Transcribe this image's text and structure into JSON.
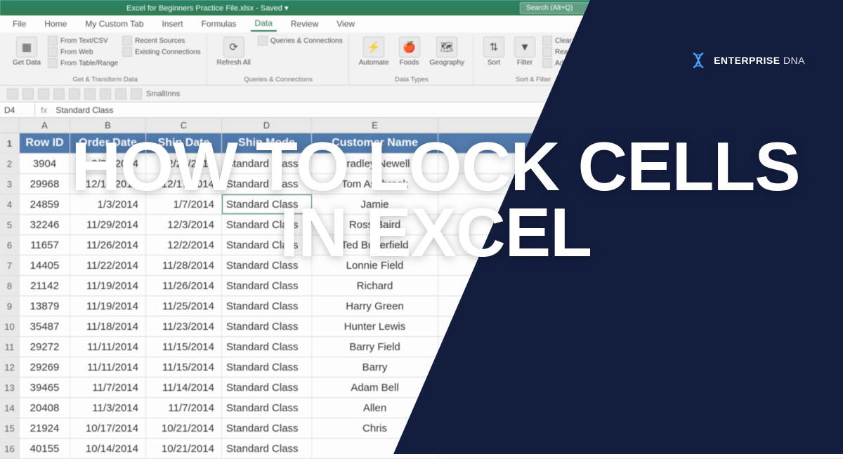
{
  "window": {
    "title": "Excel for Beginners Practice File.xlsx - Saved ▾",
    "search_placeholder": "Search (Alt+Q)"
  },
  "menu": {
    "file": "File",
    "home": "Home",
    "custom": "My Custom Tab",
    "insert": "Insert",
    "formulas": "Formulas",
    "data": "Data",
    "review": "Review",
    "view": "View"
  },
  "ribbon": {
    "get_data": "Get Data",
    "from_text": "From Text/CSV",
    "from_web": "From Web",
    "from_table": "From Table/Range",
    "recent": "Recent Sources",
    "existing": "Existing Connections",
    "group1_label": "Get & Transform Data",
    "refresh": "Refresh All",
    "queries": "Queries & Connections",
    "group2_label": "Queries & Connections",
    "automate": "Automate",
    "foods": "Foods",
    "geography": "Geography",
    "group3_label": "Data Types",
    "sort": "Sort",
    "filter": "Filter",
    "clear": "Clear",
    "reapply": "Reapply",
    "advanced": "Advanced",
    "group4_label": "Sort & Filter"
  },
  "qat": {
    "smallinns": "SmallInns"
  },
  "cell_ref": "D4",
  "formula_value": "Standard Class",
  "columns": [
    "",
    "A",
    "B",
    "C",
    "D",
    "E"
  ],
  "headers": {
    "a": "Row ID",
    "b": "Order Date",
    "c": "Ship Date",
    "d": "Ship Mode",
    "e": "Customer Name"
  },
  "rows": [
    {
      "n": 2,
      "a": "3904",
      "b": "2/20/2014",
      "c": "2/25/2014",
      "d": "Standard Class",
      "e": "Bradley Newell"
    },
    {
      "n": 3,
      "a": "29968",
      "b": "12/14/2014",
      "c": "12/17/2014",
      "d": "Standard Class",
      "e": "Tom Ashbrook"
    },
    {
      "n": 4,
      "a": "24859",
      "b": "1/3/2014",
      "c": "1/7/2014",
      "d": "Standard Class",
      "e": "Jamie"
    },
    {
      "n": 5,
      "a": "32246",
      "b": "11/29/2014",
      "c": "12/3/2014",
      "d": "Standard Class",
      "e": "Ross Baird"
    },
    {
      "n": 6,
      "a": "11657",
      "b": "11/26/2014",
      "c": "12/2/2014",
      "d": "Standard Class",
      "e": "Ted Butterfield"
    },
    {
      "n": 7,
      "a": "14405",
      "b": "11/22/2014",
      "c": "11/28/2014",
      "d": "Standard Class",
      "e": "Lonnie Field"
    },
    {
      "n": 8,
      "a": "21142",
      "b": "11/19/2014",
      "c": "11/26/2014",
      "d": "Standard Class",
      "e": "Richard"
    },
    {
      "n": 9,
      "a": "13879",
      "b": "11/19/2014",
      "c": "11/25/2014",
      "d": "Standard Class",
      "e": "Harry Green"
    },
    {
      "n": 10,
      "a": "35487",
      "b": "11/18/2014",
      "c": "11/23/2014",
      "d": "Standard Class",
      "e": "Hunter Lewis"
    },
    {
      "n": 11,
      "a": "29272",
      "b": "11/11/2014",
      "c": "11/15/2014",
      "d": "Standard Class",
      "e": "Barry Field"
    },
    {
      "n": 12,
      "a": "29269",
      "b": "11/11/2014",
      "c": "11/15/2014",
      "d": "Standard Class",
      "e": "Barry"
    },
    {
      "n": 13,
      "a": "39465",
      "b": "11/7/2014",
      "c": "11/14/2014",
      "d": "Standard Class",
      "e": "Adam Bell"
    },
    {
      "n": 14,
      "a": "20408",
      "b": "11/3/2014",
      "c": "11/7/2014",
      "d": "Standard Class",
      "e": "Allen"
    },
    {
      "n": 15,
      "a": "21924",
      "b": "10/17/2014",
      "c": "10/21/2014",
      "d": "Standard Class",
      "e": "Chris"
    },
    {
      "n": 16,
      "a": "40155",
      "b": "10/14/2014",
      "c": "10/21/2014",
      "d": "Standard Class",
      "e": ""
    }
  ],
  "overlay": {
    "headline": "HOW TO LOCK CELLS IN EXCEL",
    "logo_bold": "ENTERPRISE",
    "logo_light": "DNA",
    "shape_color": "#131d3e"
  }
}
